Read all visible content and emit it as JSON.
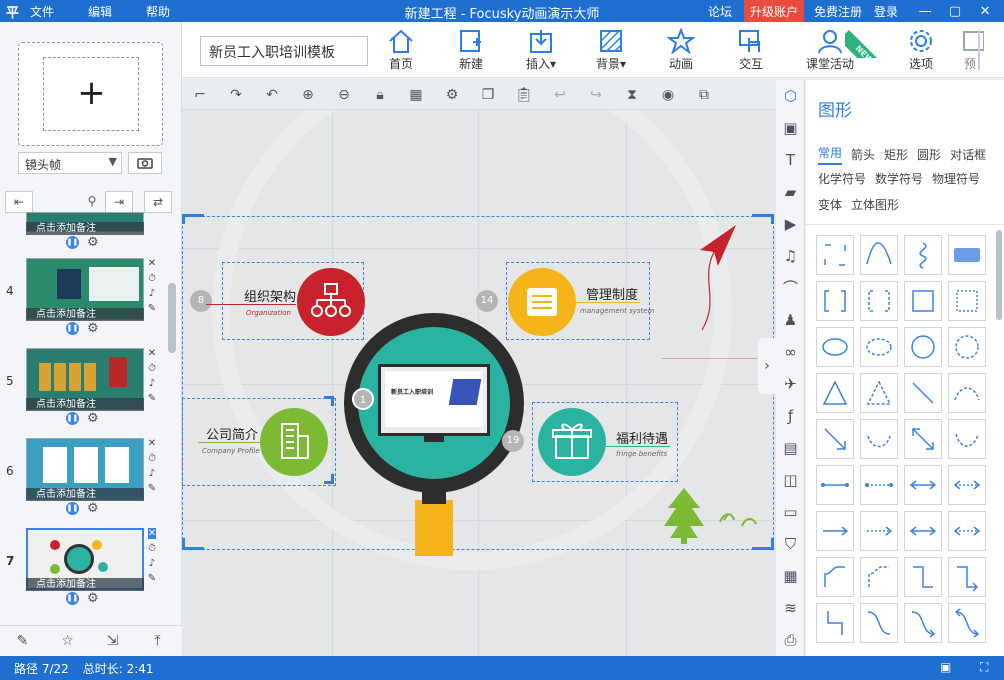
{
  "titlebar": {
    "logo": "平",
    "menu": [
      "文件",
      "编辑",
      "帮助"
    ],
    "title": "新建工程 - Focusky动画演示大师",
    "forum": "论坛",
    "upgrade": "升级账户",
    "register": "免费注册",
    "login": "登录",
    "minimize": "—",
    "maximize": "▢",
    "close": "✕"
  },
  "toolbar": {
    "project_name": "新员工入职培训模板",
    "tools": [
      {
        "label": "首页",
        "icon": "home-icon"
      },
      {
        "label": "新建",
        "icon": "new-icon"
      },
      {
        "label": "插入▾",
        "icon": "insert-icon"
      },
      {
        "label": "背景▾",
        "icon": "background-icon"
      },
      {
        "label": "动画",
        "icon": "animation-icon"
      },
      {
        "label": "交互",
        "icon": "interaction-icon"
      },
      {
        "label": "课堂活动",
        "icon": "classroom-icon"
      },
      {
        "label": "选项",
        "icon": "options-icon"
      },
      {
        "label": "预",
        "icon": "preview-icon"
      }
    ],
    "new_badge": "NEW"
  },
  "leftpanel": {
    "add_frame": "+",
    "frame_type": "镜头帧",
    "thumbs": [
      {
        "num": "",
        "note": "点击添加备注"
      },
      {
        "num": "4",
        "note": "点击添加备注"
      },
      {
        "num": "5",
        "note": "点击添加备注"
      },
      {
        "num": "6",
        "note": "点击添加备注"
      },
      {
        "num": "7",
        "note": "点击添加备注"
      }
    ]
  },
  "canvas": {
    "items": [
      {
        "num": "8",
        "title": "组织架构",
        "sub": "Organization"
      },
      {
        "num": "14",
        "title": "管理制度",
        "sub": "management system"
      },
      {
        "num": "1",
        "title": "新员工入职培训",
        "sub": ""
      },
      {
        "num": "19",
        "title": "福利待遇",
        "sub": "fringe benefits"
      },
      {
        "num": "",
        "title": "公司简介",
        "sub": "Company Profile"
      }
    ]
  },
  "shapes_panel": {
    "title": "图形",
    "categories": [
      "常用",
      "箭头",
      "矩形",
      "圆形",
      "对话框",
      "化学符号",
      "数学符号",
      "物理符号",
      "变体",
      "立体图形"
    ]
  },
  "status": {
    "path": "路径 7/22",
    "duration": "总时长: 2:41"
  },
  "colors": {
    "accent": "#1e6fd0",
    "upgrade": "#e94b3c",
    "red_circle": "#c8232c",
    "yellow_circle": "#f5b51a",
    "green_circle": "#7cba35",
    "teal_circle": "#2bb3a2",
    "magnifier_rim": "#3b3b3b",
    "magnifier_handle": "#f5b51a"
  }
}
